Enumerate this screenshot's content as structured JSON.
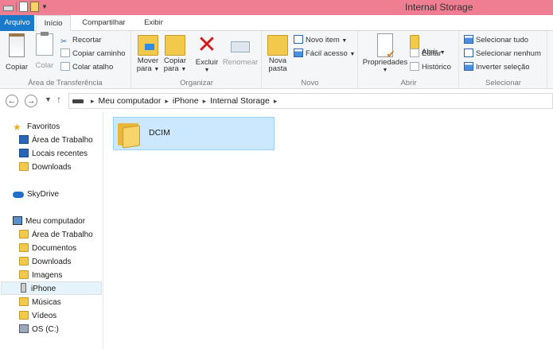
{
  "window": {
    "title": "Internal Storage"
  },
  "quick_access": {
    "icons": [
      "drive-icon",
      "properties-doc-icon",
      "new-folder-icon",
      "customize-dropdown-icon"
    ]
  },
  "tabs": [
    {
      "label": "Arquivo"
    },
    {
      "label": "Início"
    },
    {
      "label": "Compartilhar"
    },
    {
      "label": "Exibir"
    }
  ],
  "ribbon": {
    "clipboard": {
      "label": "Área de Transferência",
      "copy": "Copiar",
      "paste": "Colar",
      "cut": "Recortar",
      "copy_path": "Copiar caminho",
      "paste_shortcut": "Colar atalho"
    },
    "organize": {
      "label": "Organizar",
      "move_to_1": "Mover",
      "move_to_2": "para",
      "copy_to_1": "Copiar",
      "copy_to_2": "para",
      "delete": "Excluir",
      "rename": "Renomear"
    },
    "new": {
      "label": "Novo",
      "new_folder_1": "Nova",
      "new_folder_2": "pasta",
      "new_item": "Novo item",
      "easy_access": "Fácil acesso"
    },
    "open": {
      "label": "Abrir",
      "properties": "Propriedades",
      "open": "Abrir",
      "edit": "Editar",
      "history": "Histórico"
    },
    "select": {
      "label": "Selecionar",
      "select_all": "Selecionar tudo",
      "select_none": "Selecionar nenhum",
      "invert": "Inverter seleção"
    }
  },
  "address": {
    "crumbs": [
      "Meu computador",
      "iPhone",
      "Internal Storage"
    ]
  },
  "nav": {
    "favorites": "Favoritos",
    "fav_items": [
      "Área de Trabalho",
      "Locais recentes",
      "Downloads"
    ],
    "skydrive": "SkyDrive",
    "computer": "Meu computador",
    "pc_items": [
      "Área de Trabalho",
      "Documentos",
      "Downloads",
      "Imagens",
      "iPhone",
      "Músicas",
      "Vídeos",
      "OS (C:)"
    ]
  },
  "content": {
    "items": [
      {
        "name": "DCIM",
        "type": "folder"
      }
    ]
  },
  "colors": {
    "titlebar": "#ef7e93",
    "file_tab": "#1979ca",
    "selection": "#cce8ff"
  }
}
